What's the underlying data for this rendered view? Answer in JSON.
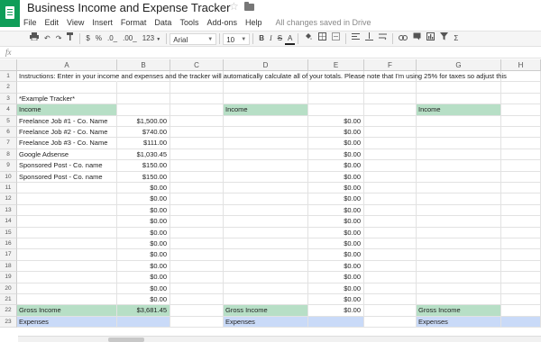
{
  "app": {
    "title": "Business Income and Expense Tracker",
    "save_status": "All changes saved in Drive",
    "brand_color": "#0f9d58"
  },
  "menu": [
    "File",
    "Edit",
    "View",
    "Insert",
    "Format",
    "Data",
    "Tools",
    "Add-ons",
    "Help"
  ],
  "toolbar": {
    "currency": "$",
    "percent": "%",
    "dec_decrease": ".0_",
    "dec_increase": ".00_",
    "more_formats": "123",
    "font": "Arial",
    "font_size": "10",
    "bold": "B",
    "italic": "I",
    "strike": "S",
    "text_color": "A",
    "functions": "Σ"
  },
  "formula_bar": {
    "fx": "fx",
    "value": ""
  },
  "columns": [
    "A",
    "B",
    "C",
    "D",
    "E",
    "F",
    "G",
    "H"
  ],
  "rows": [
    {
      "n": "1",
      "A": "Instructions: Enter in your income and expenses and the tracker will automatically calculate all of your totals. Please note that I'm using 25% for taxes so adjust this"
    },
    {
      "n": "2"
    },
    {
      "n": "3",
      "A": "*Example Tracker*"
    },
    {
      "n": "4",
      "A": "Income",
      "D": "Income",
      "G": "Income",
      "style": "green"
    },
    {
      "n": "5",
      "A": "Freelance Job #1 - Co. Name",
      "B": "$1,500.00",
      "E": "$0.00"
    },
    {
      "n": "6",
      "A": "Freelance Job #2 - Co. Name",
      "B": "$740.00",
      "E": "$0.00"
    },
    {
      "n": "7",
      "A": "Freelance Job #3 - Co. Name",
      "B": "$111.00",
      "E": "$0.00"
    },
    {
      "n": "8",
      "A": "Google Adsense",
      "B": "$1,030.45",
      "E": "$0.00"
    },
    {
      "n": "9",
      "A": "Sponsored Post - Co. name",
      "B": "$150.00",
      "E": "$0.00"
    },
    {
      "n": "10",
      "A": "Sponsored Post - Co. name",
      "B": "$150.00",
      "E": "$0.00"
    },
    {
      "n": "11",
      "B": "$0.00",
      "E": "$0.00"
    },
    {
      "n": "12",
      "B": "$0.00",
      "E": "$0.00"
    },
    {
      "n": "13",
      "B": "$0.00",
      "E": "$0.00"
    },
    {
      "n": "14",
      "B": "$0.00",
      "E": "$0.00"
    },
    {
      "n": "15",
      "B": "$0.00",
      "E": "$0.00"
    },
    {
      "n": "16",
      "B": "$0.00",
      "E": "$0.00"
    },
    {
      "n": "17",
      "B": "$0.00",
      "E": "$0.00"
    },
    {
      "n": "18",
      "B": "$0.00",
      "E": "$0.00"
    },
    {
      "n": "19",
      "B": "$0.00",
      "E": "$0.00"
    },
    {
      "n": "20",
      "B": "$0.00",
      "E": "$0.00"
    },
    {
      "n": "21",
      "B": "$0.00",
      "E": "$0.00"
    },
    {
      "n": "22",
      "A": "Gross Income",
      "B": "$3,681.45",
      "D": "Gross Income",
      "E": "$0.00",
      "G": "Gross Income",
      "style": "green-total"
    },
    {
      "n": "23",
      "A": "Expenses",
      "D": "Expenses",
      "G": "Expenses",
      "style": "blue"
    }
  ]
}
